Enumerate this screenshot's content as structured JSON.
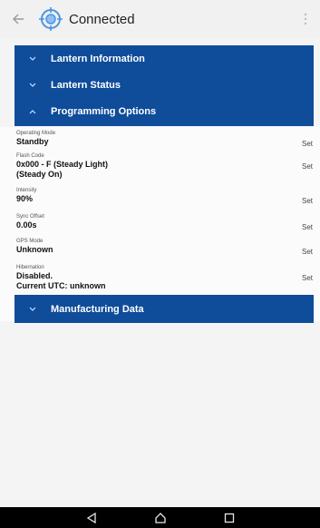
{
  "header": {
    "title": "Connected"
  },
  "sections": {
    "lantern_information": "Lantern Information",
    "lantern_status": "Lantern Status",
    "programming_options": "Programming Options",
    "manufacturing_data": "Manufacturing Data"
  },
  "programming": [
    {
      "label": "Operating Mode",
      "value": "Standby",
      "action": "Set"
    },
    {
      "label": "Flash Code",
      "value": "0x000 - F (Steady Light)",
      "value2": "(Steady On)",
      "action": "Set"
    },
    {
      "label": "Intensity",
      "value": "90%",
      "action": "Set"
    },
    {
      "label": "Sync Offset",
      "value": "0.00s",
      "action": "Set"
    },
    {
      "label": "GPS Mode",
      "value": "Unknown",
      "action": "Set"
    },
    {
      "label": "Hibernation",
      "value": "Disabled.",
      "value2": "Current UTC: unknown",
      "action": "Set"
    }
  ],
  "colors": {
    "accent": "#0f4c9a",
    "navbar": "#000000"
  },
  "icons": {
    "back": "back-arrow-icon",
    "logo": "lantern-target-icon",
    "more": "more-vert-icon",
    "nav_back": "nav-back-icon",
    "nav_home": "nav-home-icon",
    "nav_recents": "nav-recents-icon"
  }
}
